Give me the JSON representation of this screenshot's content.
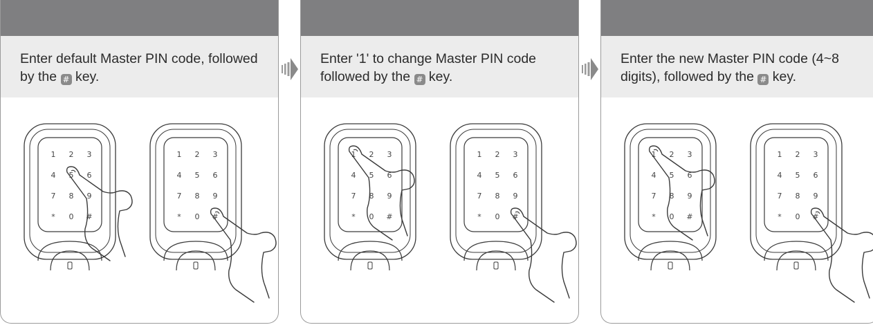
{
  "steps": [
    {
      "text_before": "Enter default Master PIN code, followed by the ",
      "key_glyph": "#",
      "text_after": " key.",
      "keypads": [
        {
          "keys": [
            "1",
            "2",
            "3",
            "4",
            "5",
            "6",
            "7",
            "8",
            "9",
            "*",
            "0",
            "#"
          ],
          "finger_on": "5"
        },
        {
          "keys": [
            "1",
            "2",
            "3",
            "4",
            "5",
            "6",
            "7",
            "8",
            "9",
            "*",
            "0",
            "#"
          ],
          "finger_on": "#"
        }
      ]
    },
    {
      "text_before": "Enter '1' to change Master PIN code followed by the ",
      "key_glyph": "#",
      "text_after": " key.",
      "keypads": [
        {
          "keys": [
            "1",
            "2",
            "3",
            "4",
            "5",
            "6",
            "7",
            "8",
            "9",
            "*",
            "0",
            "#"
          ],
          "finger_on": "1"
        },
        {
          "keys": [
            "1",
            "2",
            "3",
            "4",
            "5",
            "6",
            "7",
            "8",
            "9",
            "*",
            "0",
            "#"
          ],
          "finger_on": "#"
        }
      ]
    },
    {
      "text_before": "Enter the new Master PIN code (4~8 digits), followed by the ",
      "key_glyph": "#",
      "text_after": " key.",
      "keypads": [
        {
          "keys": [
            "1",
            "2",
            "3",
            "4",
            "5",
            "6",
            "7",
            "8",
            "9",
            "*",
            "0",
            "#"
          ],
          "finger_on": "1"
        },
        {
          "keys": [
            "1",
            "2",
            "3",
            "4",
            "5",
            "6",
            "7",
            "8",
            "9",
            "*",
            "0",
            "#"
          ],
          "finger_on": "#"
        }
      ]
    }
  ],
  "colors": {
    "header_bar": "#7f7f81",
    "caption_bg": "#ececec",
    "key_badge": "#8a8a8a",
    "line": "#3a3a3a"
  },
  "icons": {
    "step_arrow": "right-arrow-icon",
    "hash_key": "hash-key-icon"
  }
}
